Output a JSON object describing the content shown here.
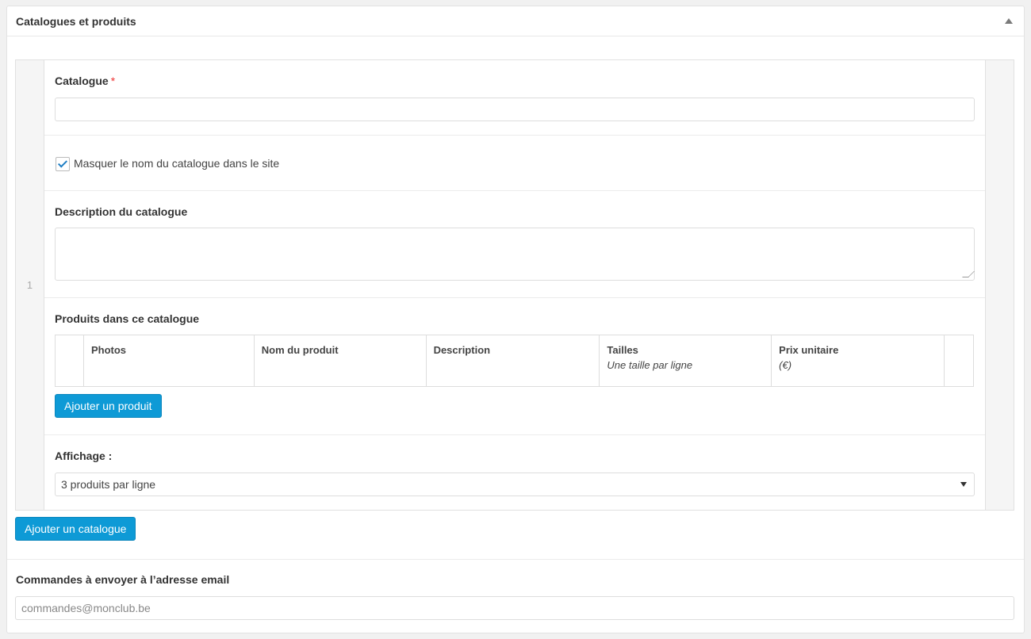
{
  "panel": {
    "title": "Catalogues et produits"
  },
  "catalogue_row": {
    "index": "1",
    "catalogue_label": "Catalogue",
    "required_mark": "*",
    "catalogue_value": "",
    "hide_name_label": "Masquer le nom du catalogue dans le site",
    "hide_name_checked": true,
    "description_label": "Description du catalogue",
    "description_value": "",
    "products_label": "Produits dans ce catalogue",
    "products_table": {
      "columns": [
        {
          "label": "Photos",
          "sub": ""
        },
        {
          "label": "Nom du produit",
          "sub": ""
        },
        {
          "label": "Description",
          "sub": ""
        },
        {
          "label": "Tailles",
          "sub": "Une taille par ligne"
        },
        {
          "label": "Prix unitaire",
          "sub": "(€)"
        }
      ]
    },
    "add_product_label": "Ajouter un produit",
    "display_label": "Affichage :",
    "display_value": "3 produits par ligne"
  },
  "add_catalogue_label": "Ajouter un catalogue",
  "email": {
    "label": "Commandes à envoyer à l’adresse email",
    "placeholder": "commandes@monclub.be"
  },
  "colors": {
    "accent": "#0e9ad6",
    "required": "#ee3333",
    "check": "#1e7ec4"
  },
  "icons": {
    "collapse": "triangle-up-icon",
    "select": "caret-down-icon",
    "check": "checkmark-icon"
  }
}
